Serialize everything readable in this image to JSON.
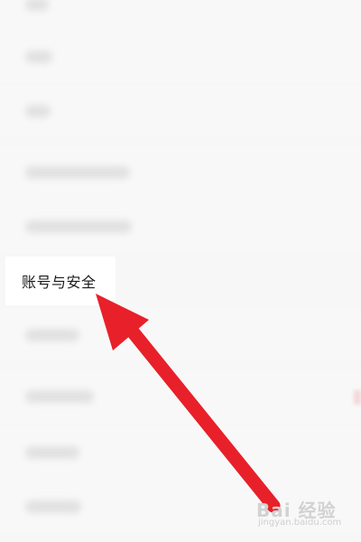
{
  "settings": {
    "focused_item": {
      "label": "账号与安全"
    }
  },
  "watermark": {
    "main": "Bai 经验",
    "sub": "jingyan.baidu.com"
  },
  "colors": {
    "arrow": "#e8202a",
    "background": "#f7f7f7",
    "focus_row": "#ffffff"
  },
  "icons": {
    "annotation": "red-arrow-icon",
    "watermark": "baidu-paw-icon"
  }
}
